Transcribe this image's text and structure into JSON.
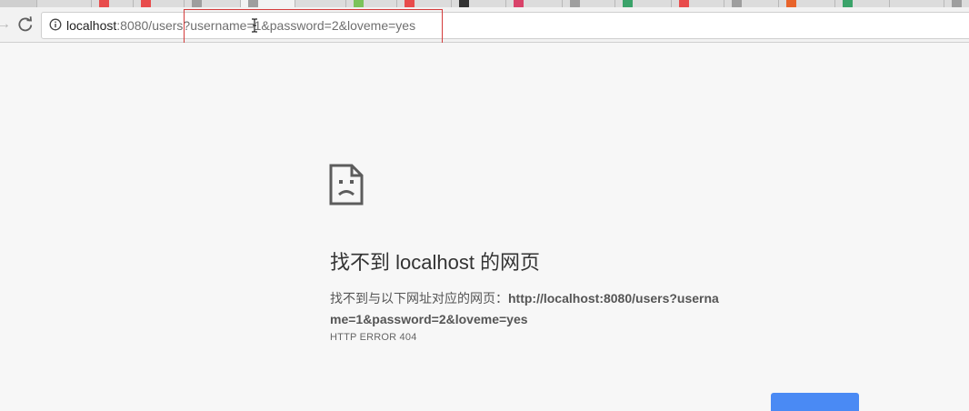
{
  "browser": {
    "tab_favicon_colors": [
      "#e84c4c",
      "#e84c4c",
      "#9e9e9e",
      "#9e9e9e",
      "#e84c4c",
      "#7cc35a",
      "#e84c4c",
      "#333333",
      "#d9436a",
      "#9e9e9e",
      "#3ba36a",
      "#e84c4c",
      "#9e9e9e",
      "#e8642b",
      "#3ba36a",
      "#9e9e9e"
    ],
    "address_bar": {
      "url_host": "localhost",
      "url_rest": ":8080/users?username=1&password=2&loveme=yes"
    },
    "annotation_color": "#d43b3b"
  },
  "error_page": {
    "title": "找不到 localhost 的网页",
    "description_prefix": "找不到与以下网址对应的网页：",
    "description_url": "http://localhost:8080/users?username=1&password=2&loveme=yes",
    "error_code": "HTTP ERROR 404",
    "button_color": "#4a8af4"
  }
}
